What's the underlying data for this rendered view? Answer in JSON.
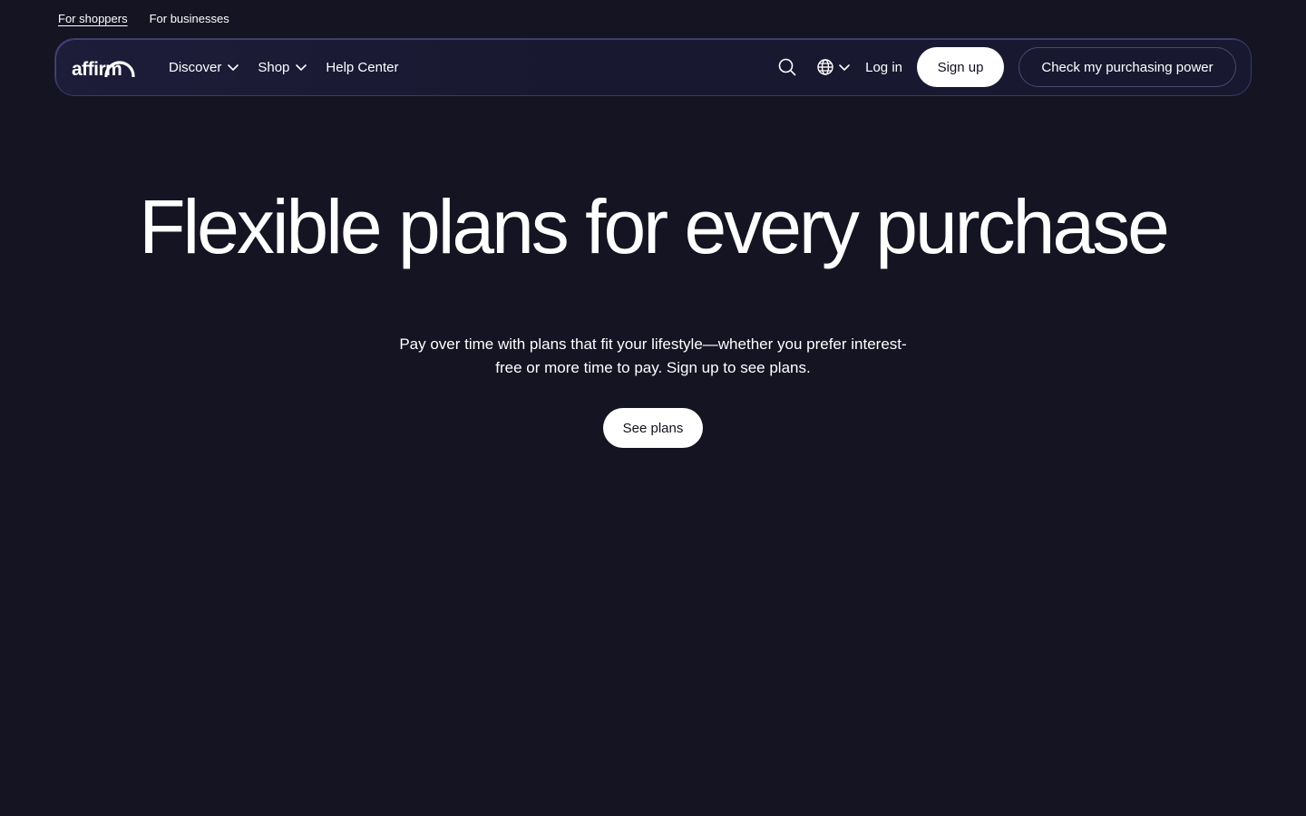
{
  "top_links": {
    "shoppers": "For shoppers",
    "businesses": "For businesses"
  },
  "nav": {
    "logo_text": "affirm",
    "discover": "Discover",
    "shop": "Shop",
    "help_center": "Help Center",
    "login": "Log in",
    "signup": "Sign up",
    "purchasing_power": "Check my purchasing power"
  },
  "hero": {
    "title": "Flexible plans for every purchase",
    "subtitle_line1": "Pay over time with plans that fit your lifestyle—whether you prefer interest-",
    "subtitle_line2": "free or more time to pay. Sign up to see plans.",
    "cta": "See plans"
  },
  "colors": {
    "background": "#141423",
    "navbar_border": "#3a3a64",
    "button_bg": "#ffffff",
    "button_text": "#101020"
  },
  "icons": [
    "search-icon",
    "globe-icon",
    "chevron-down-icon"
  ]
}
